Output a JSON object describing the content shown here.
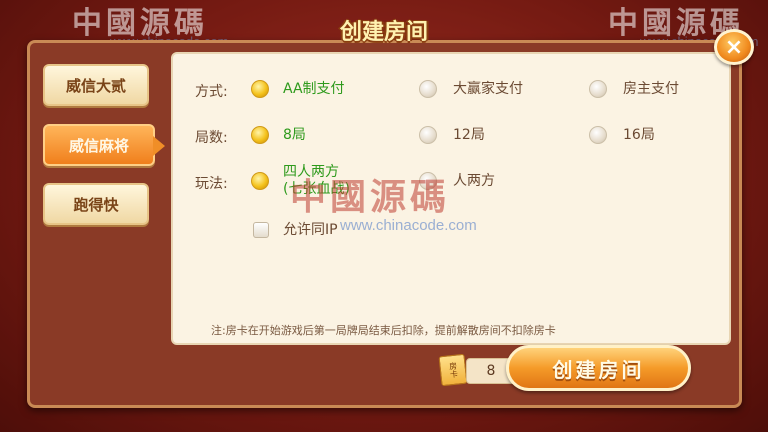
{
  "title": "创建房间",
  "close_symbol": "×",
  "sidebar": {
    "items": [
      {
        "label": "威信大贰",
        "active": false
      },
      {
        "label": "威信麻将",
        "active": true
      },
      {
        "label": "跑得快",
        "active": false
      }
    ]
  },
  "options": {
    "payment": {
      "label": "方式:",
      "choices": [
        "AA制支付",
        "大赢家支付",
        "房主支付"
      ],
      "selected": "AA制支付"
    },
    "rounds": {
      "label": "局数:",
      "choices": [
        "8局",
        "12局",
        "16局"
      ],
      "selected": "8局"
    },
    "play": {
      "label": "玩法:",
      "choices": [
        "四人两方\n(七张血战)",
        "人两方"
      ],
      "selected": "四人两方\n(七张血战)",
      "checkbox_label": "允许同IP",
      "checkbox_checked": false
    }
  },
  "note": "注:房卡在开始游戏后第一局牌局结束后扣除，提前解散房间不扣除房卡",
  "footer": {
    "card_icon_text": "房卡",
    "card_count": "8",
    "create_button_label": "创建房间"
  },
  "watermark": {
    "text": "中國源碼",
    "url": "www.chinacode.com"
  },
  "colors": {
    "accent_orange": "#f08a1e",
    "selected_green": "#2e9a1c",
    "panel_bg": "#fbf3e3"
  }
}
